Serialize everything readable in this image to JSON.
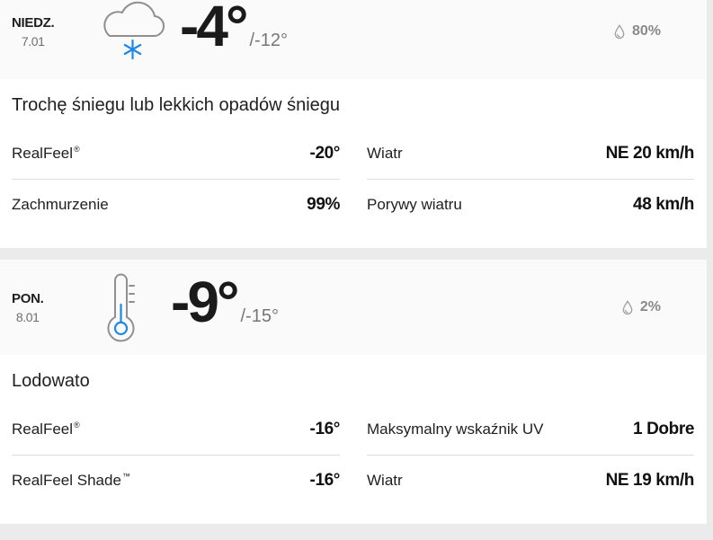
{
  "colors": {
    "accent": "#1e88e5",
    "icon_outline": "#8f8f8f",
    "droplet": "#a0a0a0"
  },
  "days": [
    {
      "day": "NIEDZ.",
      "date": "7.01",
      "icon": "cloud-snow-icon",
      "temp_high": "-4°",
      "temp_low": "/-12°",
      "precip_icon": "droplet-icon",
      "precip": "80%",
      "phrase": "Trochę śniegu lub lekkich opadów śniegu",
      "details": {
        "left": [
          {
            "label": "RealFeel",
            "mark": "®",
            "value": "-20°"
          },
          {
            "label": "Zachmurzenie",
            "mark": "",
            "value": "99%"
          }
        ],
        "right": [
          {
            "label": "Wiatr",
            "mark": "",
            "value": "NE 20 km/h"
          },
          {
            "label": "Porywy wiatru",
            "mark": "",
            "value": "48 km/h"
          }
        ]
      }
    },
    {
      "day": "PON.",
      "date": "8.01",
      "icon": "thermometer-icon",
      "temp_high": "-9°",
      "temp_low": "/-15°",
      "precip_icon": "droplet-icon",
      "precip": "2%",
      "phrase": "Lodowato",
      "details": {
        "left": [
          {
            "label": "RealFeel",
            "mark": "®",
            "value": "-16°"
          },
          {
            "label": "RealFeel Shade",
            "mark": "™",
            "value": "-16°"
          }
        ],
        "right": [
          {
            "label": "Maksymalny wskaźnik UV",
            "mark": "",
            "value": "1 Dobre"
          },
          {
            "label": "Wiatr",
            "mark": "",
            "value": "NE 19 km/h"
          }
        ]
      }
    }
  ]
}
